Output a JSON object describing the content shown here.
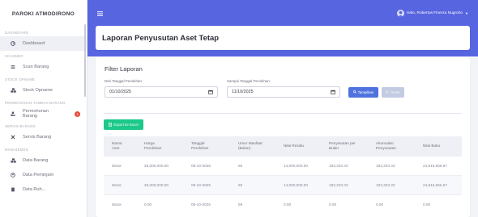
{
  "sidebar": {
    "brand": "PAROKI ATMODIRONO",
    "sections": {
      "dashboard": "DASHBOARD",
      "scanner": "SCANNER",
      "stock_opname": "STOCK OPNAME",
      "permohonan": "PERMOHONAN TAMBAH BARANG",
      "servis": "SERVIS BARANG",
      "manajemen": "MANAJEMEN"
    },
    "items": {
      "dashboard": "Dashboard",
      "scan_barang": "Scan Barang",
      "stock_opname": "Stock Opname",
      "permohonan_line1": "Permohonan",
      "permohonan_line2": "Barang",
      "permohonan_badge": "1",
      "servis_barang": "Servis Barang",
      "data_barang": "Data Barang",
      "data_peminjam": "Data Peminjam",
      "data_cut": "Data Ruh..."
    }
  },
  "topbar": {
    "user_name": "Halo, Robertus Finerza Nugroho"
  },
  "page": {
    "title": "Laporan Penyusutan Aset Tetap"
  },
  "filter": {
    "title": "Filter Laporan",
    "start_label": "Dari Tanggal Perolehan:",
    "start_value": "01/10/2025",
    "end_label": "Sampai Tanggal Perolehan:",
    "end_value": "11/10/2025",
    "show_button": "Tampilkan",
    "reset_button": "Reset",
    "export_button": "Export ke Excel"
  },
  "table": {
    "headers": {
      "nama_1": "Nama",
      "nama_2": "Aset",
      "harga_1": "Harga",
      "harga_2": "Perolehan",
      "tanggal_1": "Tanggal",
      "tanggal_2": "Perolehan",
      "umur_1": "Umur Manfaat",
      "umur_2": "(Bulan)",
      "residu": "Nilai Residu",
      "penyusutan_1": "Penyusutan per",
      "penyusutan_2": "Bulan",
      "akumulasi_1": "Akumulasi",
      "akumulasi_2": "Penyusutan",
      "buku": "Nilai Buku"
    },
    "rows": [
      {
        "nama": "Motor",
        "harga": "25,000,000.00",
        "tanggal": "08-10-2025",
        "umur": "60",
        "residu": "14,000,000.00",
        "penyusutan": "183,333.33",
        "akumulasi": "183,333.33",
        "buku": "24,816,666.67"
      },
      {
        "nama": "Motor",
        "harga": "25,000,000.00",
        "tanggal": "08-10-2025",
        "umur": "60",
        "residu": "14,000,000.00",
        "penyusutan": "183,333.33",
        "akumulasi": "183,333.33",
        "buku": "24,816,666.67"
      },
      {
        "nama": "Motor",
        "harga": "0.00",
        "tanggal": "08-10-2025",
        "umur": "59",
        "residu": "0.00",
        "penyusutan": "0.00",
        "akumulasi": "0.00",
        "buku": "0.00"
      }
    ]
  },
  "colors": {
    "topbar": "#5865e0",
    "primary": "#4e73df",
    "success": "#1cc88a",
    "danger": "#e74a3b"
  }
}
